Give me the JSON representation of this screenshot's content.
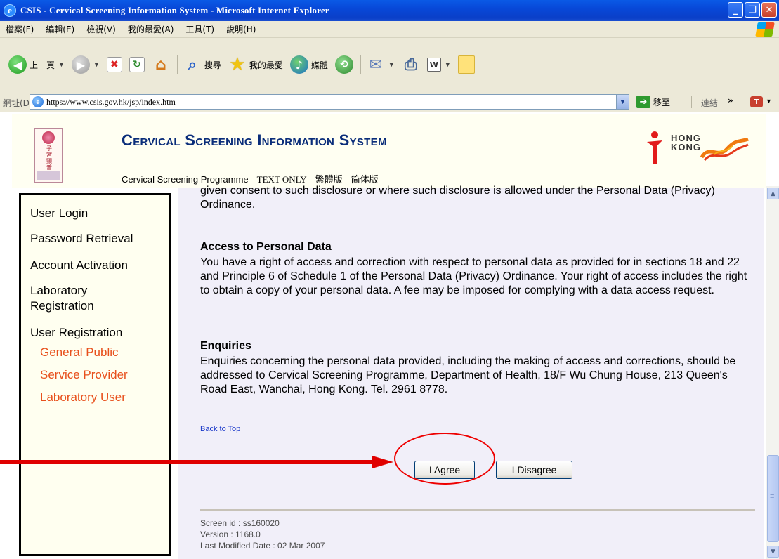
{
  "window": {
    "title": "CSIS - Cervical Screening Information System - Microsoft Internet Explorer",
    "controls": [
      "minimize",
      "maximize",
      "close"
    ]
  },
  "menubar": {
    "items": [
      "檔案(F)",
      "編輯(E)",
      "檢視(V)",
      "我的最愛(A)",
      "工具(T)",
      "說明(H)"
    ]
  },
  "toolbar": {
    "back_label": "上一頁",
    "search_label": "搜尋",
    "favorites_label": "我的最愛",
    "media_label": "媒體"
  },
  "addressbar": {
    "label": "網址(D)",
    "url": "https://www.csis.gov.hk/jsp/index.htm",
    "go_label": "移至",
    "links_label": "連結",
    "links_more": "»"
  },
  "header": {
    "site_title": "Cervical Screening Information System",
    "hk_logo_text": "HONG KONG",
    "links": [
      "Cervical Screening Programme",
      "TEXT ONLY",
      "繁體版",
      "简体版"
    ]
  },
  "sidebar": {
    "items": [
      {
        "label": "User Login"
      },
      {
        "label": "Password Retrieval"
      },
      {
        "label": "Account Activation"
      },
      {
        "label": "Laboratory Registration"
      },
      {
        "label": "User Registration"
      }
    ],
    "sub_items": [
      "General Public",
      "Service Provider",
      "Laboratory User"
    ]
  },
  "content": {
    "clipped_paragraph": "given consent to such disclosure or where such disclosure is allowed under the Personal Data (Privacy) Ordinance.",
    "access": {
      "title": "Access to Personal Data",
      "body": "You have a right of access and correction with respect to personal data as provided for in sections 18 and 22 and Principle 6 of Schedule 1 of the Personal Data (Privacy) Ordinance. Your right of access includes the right to obtain a copy of your personal data. A fee may be imposed for complying with a data access request."
    },
    "enquiries": {
      "title": "Enquiries",
      "body": "Enquiries concerning the personal data provided, including the making of access and corrections, should be addressed to Cervical Screening Programme, Department of Health, 18/F Wu Chung House, 213 Queen's Road East, Wanchai, Hong Kong. Tel. 2961 8778."
    },
    "back_to_top": "Back to Top",
    "agree_label": "I Agree",
    "disagree_label": "I Disagree"
  },
  "footer": {
    "screen_id": "Screen id : ss160020",
    "version": "Version : 1168.0",
    "last_modified": "Last Modified Date : 02 Mar 2007"
  },
  "colors": {
    "title_blue": "#0a2d7a",
    "sub_item_orange": "#e8501c",
    "link_blue": "#1a38c9",
    "content_bg": "#f1eff9",
    "annotation_red": "#e00000"
  }
}
